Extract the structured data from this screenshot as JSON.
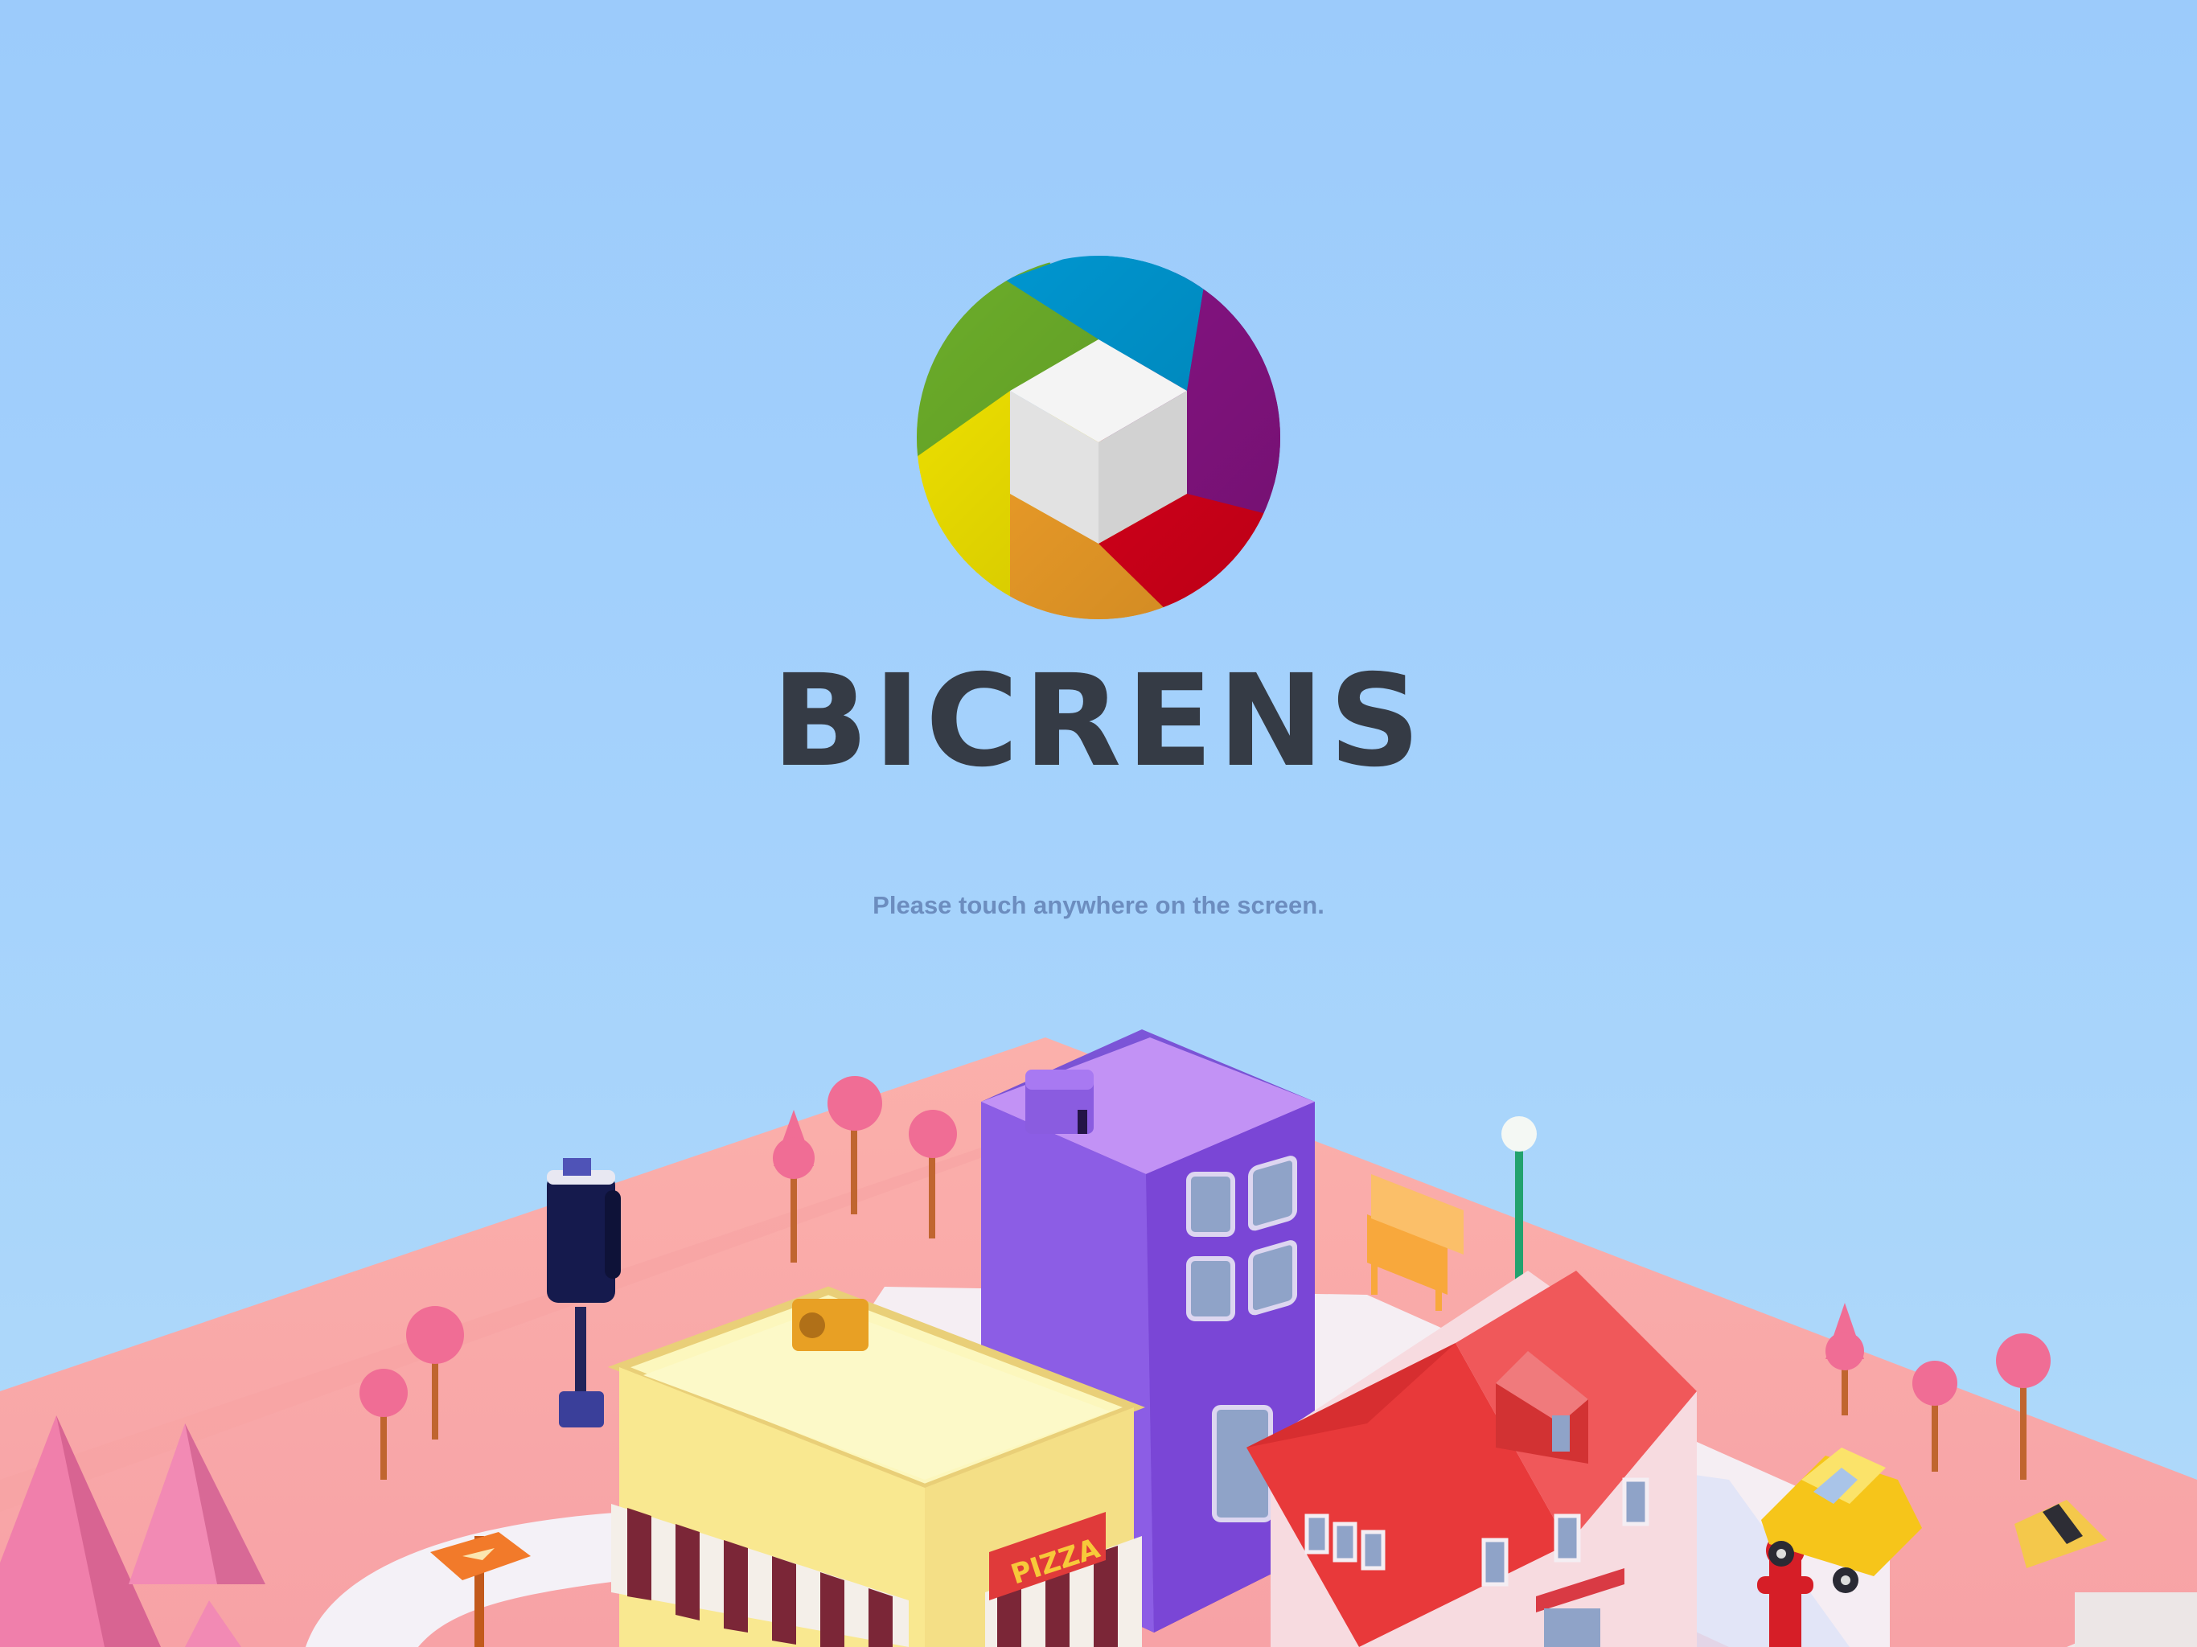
{
  "app": {
    "brand_name": "BICRENS",
    "hint": "Please touch anywhere on the screen."
  },
  "logo": {
    "icon": "cube-emblem-icon",
    "segment_colors": [
      "#0099d4",
      "#8b1488",
      "#e3001b",
      "#f9a52a",
      "#f4e600",
      "#6cae2a"
    ],
    "cube_colors": [
      "#f4f4f4",
      "#e2e2e2",
      "#d2d2d2"
    ]
  },
  "scene": {
    "icon": "isometric-city-illustration",
    "sign_text": "PIZZA",
    "colors": {
      "ground": "#fbaeaa",
      "road": "#f7f2f6",
      "tower": "#8a5ae0",
      "shop": "#fbf1a0",
      "house_roof": "#e8393a",
      "house_wall": "#f7dbe0",
      "trees": "#f06d95",
      "car": "#f6c51a"
    }
  }
}
